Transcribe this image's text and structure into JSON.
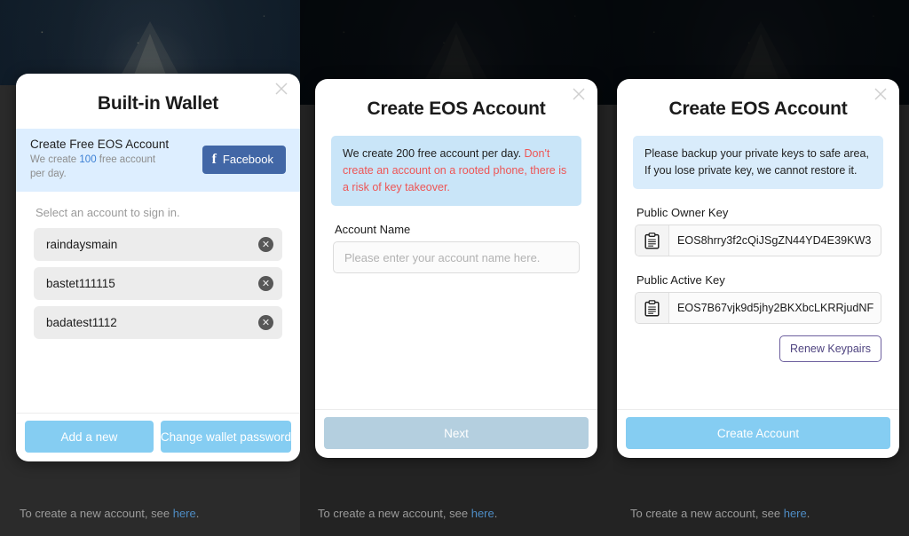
{
  "panels": [
    {
      "id": "built-in-wallet",
      "title": "Built-in Wallet",
      "close_label": "×",
      "promo": {
        "title": "Create Free EOS Account",
        "sub_prefix": "We create ",
        "sub_count": "100",
        "sub_suffix": " free account per day.",
        "facebook_label": "Facebook",
        "facebook_glyph": "f",
        "facebook_color": "#4267a6"
      },
      "select_label": "Select an account to sign in.",
      "accounts": [
        {
          "name": "raindaysmain",
          "delete_glyph": "✕"
        },
        {
          "name": "bastet111115",
          "delete_glyph": "✕"
        },
        {
          "name": "badatest1112",
          "delete_glyph": "✕"
        }
      ],
      "footer_buttons": [
        {
          "label": "Add a new",
          "style": "primary"
        },
        {
          "label": "Change wallet password",
          "style": "primary"
        }
      ],
      "hint": {
        "prefix": "To create a new account, see ",
        "link": "here",
        "suffix": "."
      }
    },
    {
      "id": "create-eos-account-step1",
      "title": "Create EOS Account",
      "close_label": "×",
      "notice": {
        "normal": "We create 200 free account per day. ",
        "warning": "Don't create an account on a rooted phone, there is a risk of key takeover."
      },
      "account_name_label": "Account Name",
      "account_name_value": "",
      "account_name_placeholder": "Please enter your account name here.",
      "footer_buttons": [
        {
          "label": "Next",
          "style": "disabled"
        }
      ],
      "hint": {
        "prefix": "To create a new account, see ",
        "link": "here",
        "suffix": "."
      }
    },
    {
      "id": "create-eos-account-step2",
      "title": "Create EOS Account",
      "close_label": "×",
      "notice": {
        "normal": "Please backup your private keys to safe area, If you lose private key, we cannot restore it.",
        "warning": ""
      },
      "keys": [
        {
          "label": "Public Owner Key",
          "value": "EOS8hrry3f2cQiJSgZN44YD4E39KW3",
          "copy_icon": "clipboard-icon"
        },
        {
          "label": "Public Active Key",
          "value": "EOS7B67vjk9d5jhy2BKXbcLKRRjudNF",
          "copy_icon": "clipboard-icon"
        }
      ],
      "renew_label": "Renew Keypairs",
      "footer_buttons": [
        {
          "label": "Create Account",
          "style": "primary"
        }
      ],
      "hint": {
        "prefix": "To create a new account, see ",
        "link": "here",
        "suffix": "."
      }
    }
  ],
  "colors": {
    "primary_button": "#85cdf2",
    "disabled_button": "#b4cfdf",
    "notice_blue": "#c9e5f8",
    "warning_red": "#ee5555",
    "facebook_blue": "#4267a6",
    "renew_purple": "#6d5f9e",
    "link_blue": "#4e8cc4",
    "app_background": "#0c1825",
    "scrim": "#232323"
  }
}
